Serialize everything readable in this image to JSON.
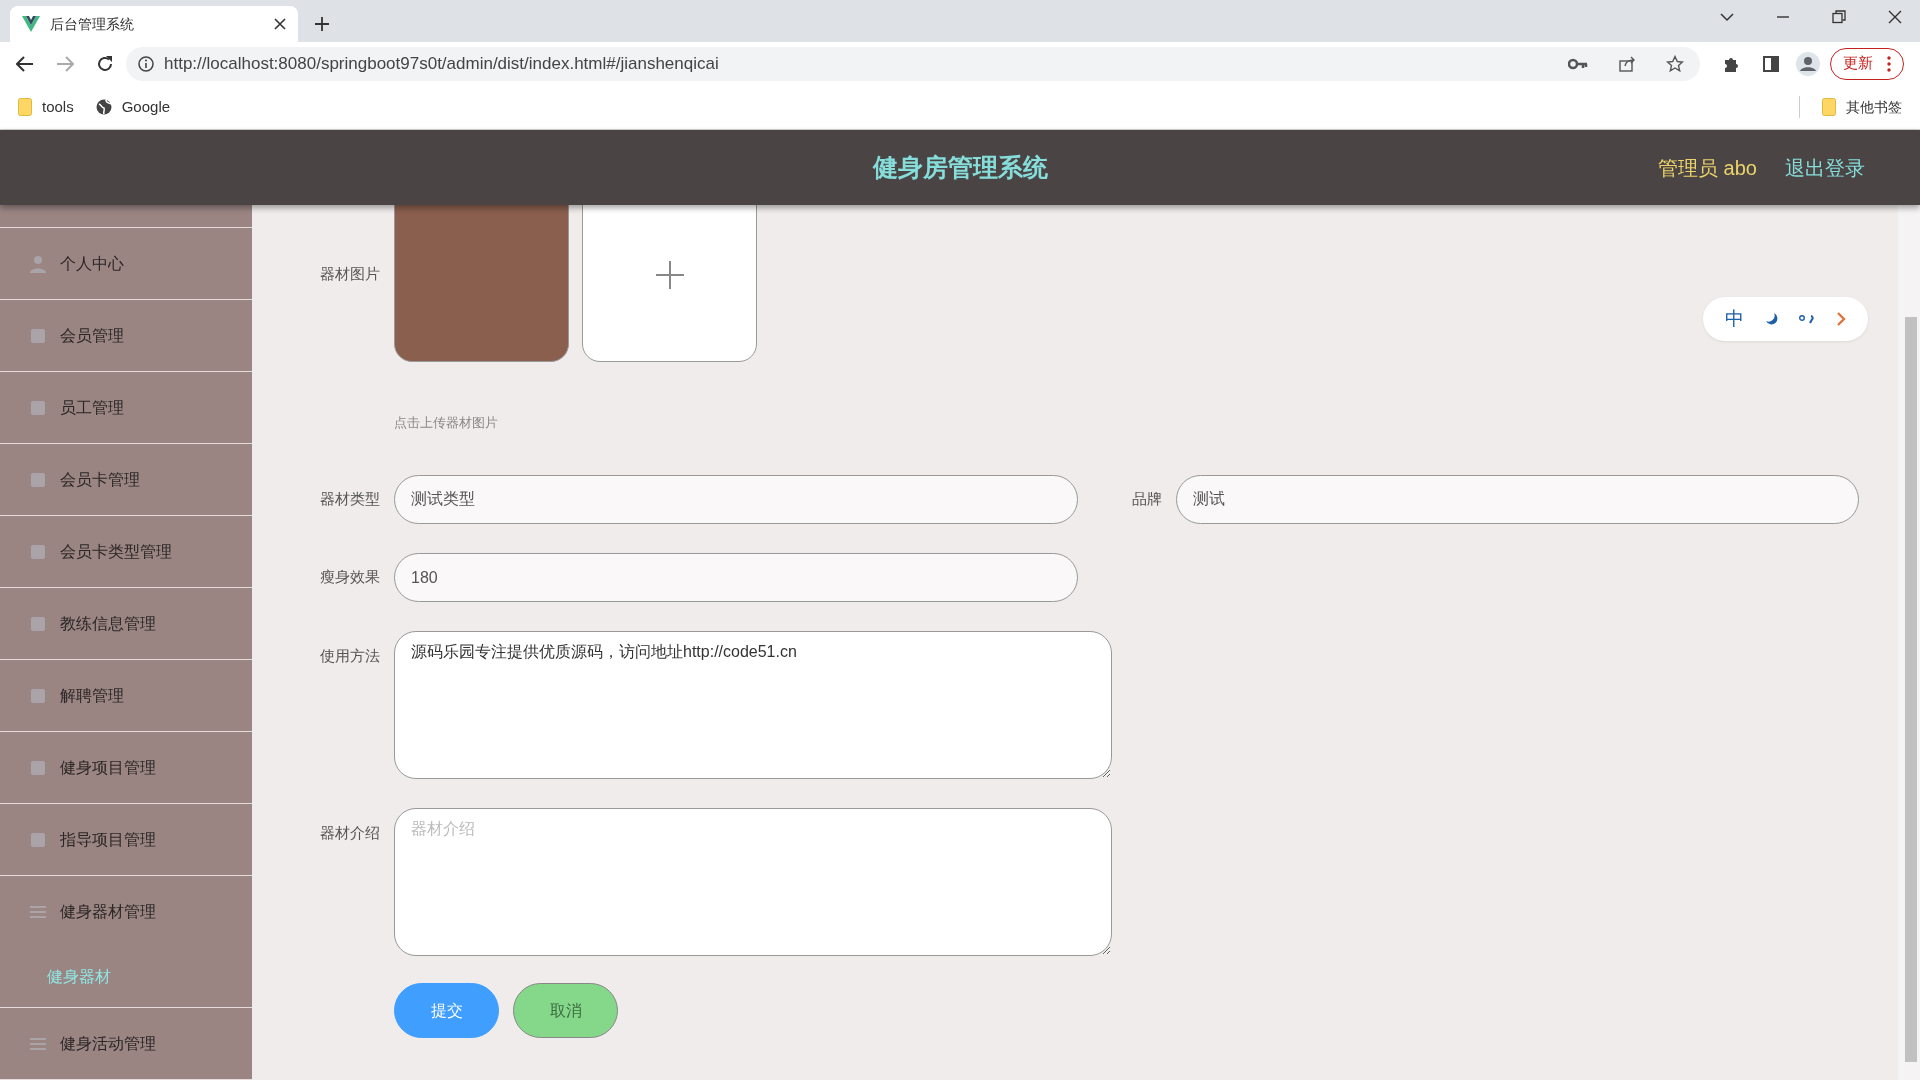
{
  "browser": {
    "tab_title": "后台管理系统",
    "url": "http://localhost:8080/springboot97s0t/admin/dist/index.html#/jianshenqicai",
    "bookmarks": [
      "tools",
      "Google"
    ],
    "other_bookmarks": "其他书签",
    "update_button": "更新"
  },
  "header": {
    "title": "健身房管理系统",
    "user": "管理员 abo",
    "logout": "退出登录"
  },
  "sidebar": {
    "items": [
      {
        "label": "个人中心",
        "selected": false
      },
      {
        "label": "会员管理",
        "selected": false
      },
      {
        "label": "员工管理",
        "selected": false
      },
      {
        "label": "会员卡管理",
        "selected": false
      },
      {
        "label": "会员卡类型管理",
        "selected": false
      },
      {
        "label": "教练信息管理",
        "selected": false
      },
      {
        "label": "解聘管理",
        "selected": false
      },
      {
        "label": "健身项目管理",
        "selected": false
      },
      {
        "label": "指导项目管理",
        "selected": false
      },
      {
        "label": "健身器材管理",
        "selected": false,
        "children": [
          {
            "label": "健身器材",
            "selected": true
          }
        ]
      },
      {
        "label": "健身活动管理",
        "selected": false
      }
    ]
  },
  "form": {
    "image": {
      "label": "器材图片",
      "hint": "点击上传器材图片"
    },
    "rows": [
      [
        {
          "kind": "input",
          "label": "器材类型",
          "value": "测试类型"
        },
        {
          "kind": "input",
          "label": "品牌",
          "value": "测试"
        }
      ],
      [
        {
          "kind": "input",
          "label": "瘦身效果",
          "value": "180"
        }
      ],
      [
        {
          "kind": "textarea",
          "label": "使用方法",
          "value": "源码乐园专注提供优质源码，访问地址http://code51.cn"
        }
      ],
      [
        {
          "kind": "textarea",
          "label": "器材介绍",
          "placeholder": "器材介绍"
        }
      ]
    ],
    "buttons": [
      {
        "kind": "primary",
        "label": "提交"
      },
      {
        "kind": "cancel",
        "label": "取消"
      }
    ]
  },
  "ime_toolbar": {
    "mode": "中"
  }
}
